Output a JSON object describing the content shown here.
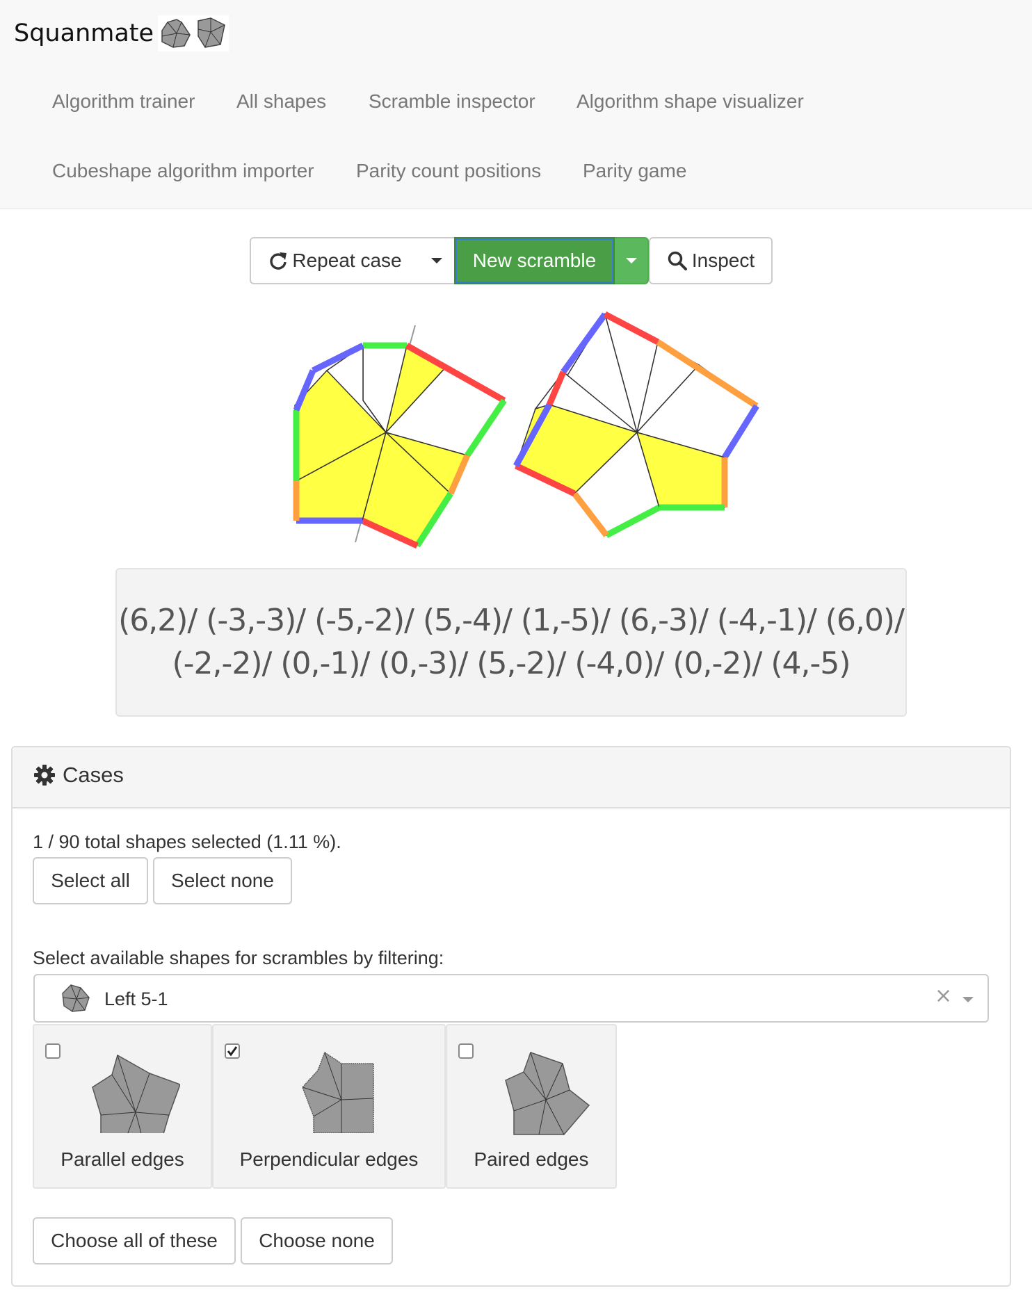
{
  "app": {
    "brand": "Squanmate"
  },
  "nav": {
    "items": [
      "Algorithm trainer",
      "All shapes",
      "Scramble inspector",
      "Algorithm shape visualizer",
      "Cubeshape algorithm importer",
      "Parity count positions",
      "Parity game"
    ]
  },
  "toolbar": {
    "repeat_label": "Repeat case",
    "new_scramble_label": "New scramble",
    "inspect_label": "Inspect"
  },
  "scramble": {
    "line1": "(6,2)/ (-3,-3)/ (-5,-2)/ (5,-4)/ (1,-5)/ (6,-3)/ (-4,-1)/ (6,0)/",
    "line2": "(-2,-2)/ (0,-1)/ (0,-3)/ (5,-2)/ (-4,0)/ (0,-2)/ (4,-5)"
  },
  "cases": {
    "title": "Cases",
    "summary": "1 / 90 total shapes selected (1.11 %).",
    "select_all": "Select all",
    "select_none": "Select none",
    "filter_label": "Select available shapes for scrambles by filtering:",
    "filter_value": "Left 5-1",
    "shapes": [
      {
        "label": "Parallel edges",
        "checked": false
      },
      {
        "label": "Perpendicular edges",
        "checked": true
      },
      {
        "label": "Paired edges",
        "checked": false
      }
    ],
    "choose_all": "Choose all of these",
    "choose_none": "Choose none"
  },
  "icons": {
    "repeat": "refresh-icon",
    "inspect": "search-icon",
    "cases": "gear-icon",
    "clear": "clear-icon",
    "dropdown": "caret-down-icon"
  },
  "colors": {
    "primary_green": "#5cb85c",
    "cube_yellow": "#ffff44",
    "edge_red": "#ff4444",
    "edge_green": "#44ee44",
    "edge_blue": "#6666ff",
    "edge_orange": "#ffa040"
  }
}
